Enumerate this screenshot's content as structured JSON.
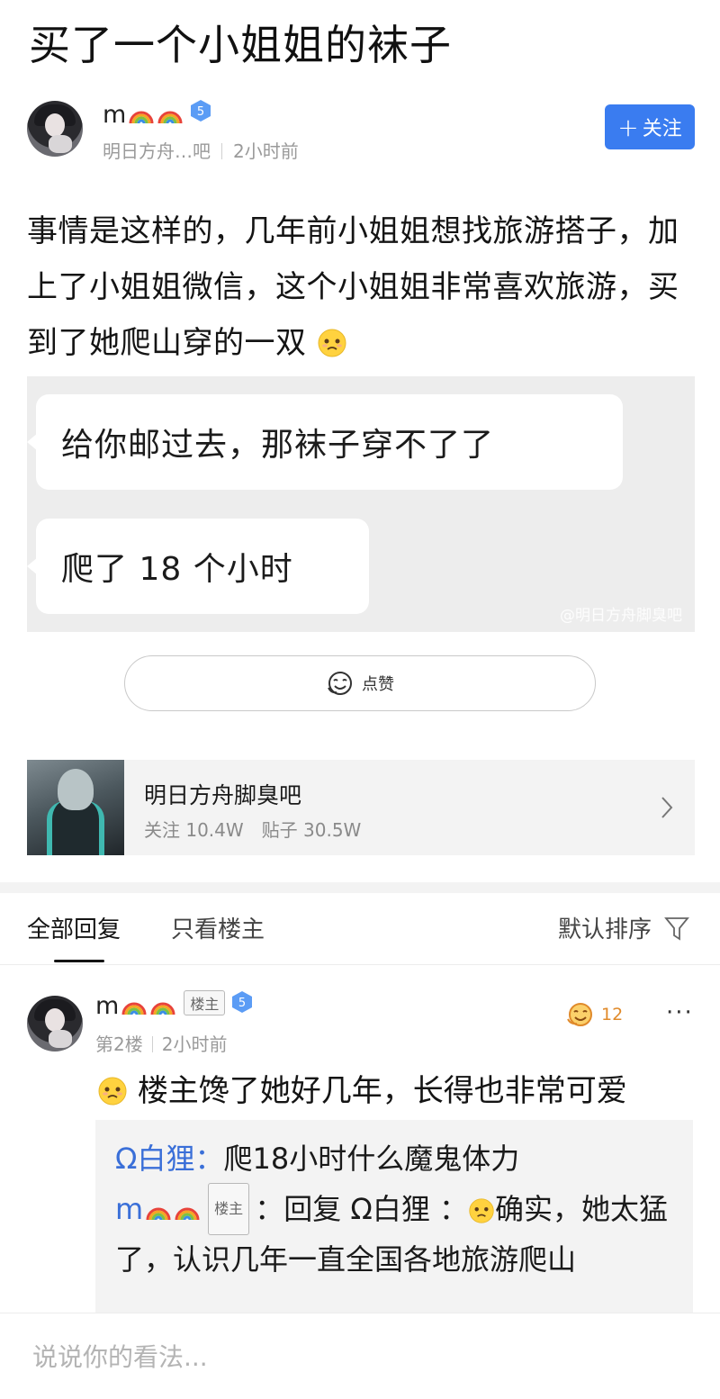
{
  "post": {
    "title": "买了一个小姐姐的袜子",
    "author": {
      "name": "m",
      "badges": [
        "rainbow-emoji",
        "rainbow-emoji"
      ],
      "level": "5",
      "forum_short": "明日方舟…吧",
      "time": "2小时前"
    },
    "follow_label": "关注",
    "body_text": "事情是这样的，几年前小姐姐想找旅游搭子，加上了小姐姐微信，这个小姐姐非常喜欢旅游，买到了她爬山穿的一双",
    "image": {
      "bubble1": "给你邮过去，那袜子穿不了了",
      "bubble2": "爬了 18 个小时",
      "watermark": "@明日方舟脚臭吧"
    },
    "like_label": "点赞"
  },
  "forum_card": {
    "name": "明日方舟脚臭吧",
    "followers": "关注 10.4W",
    "posts": "贴子 30.5W"
  },
  "reply_tabs": {
    "all": "全部回复",
    "op_only": "只看楼主",
    "sort": "默认排序"
  },
  "reply": {
    "author": "m",
    "op_tag": "楼主",
    "level": "5",
    "floor": "第2楼",
    "time": "2小时前",
    "likes": "12",
    "more": "···",
    "text": "楼主馋了她好几年，长得也非常可爱",
    "subreplies": [
      {
        "name": "Ω白狸：",
        "text": "爬18小时什么魔鬼体力"
      },
      {
        "name": "m",
        "op_tag": "楼主",
        "prefix": "：回复 Ω白狸 ：",
        "text": "确实，她太猛了，认识几年一直全国各地旅游爬山"
      }
    ]
  },
  "comment_box": {
    "placeholder": "说说你的看法..."
  },
  "colors": {
    "accent": "#3a7cf0",
    "link_name": "#3a6fd8",
    "like_orange": "#e08a2a"
  }
}
